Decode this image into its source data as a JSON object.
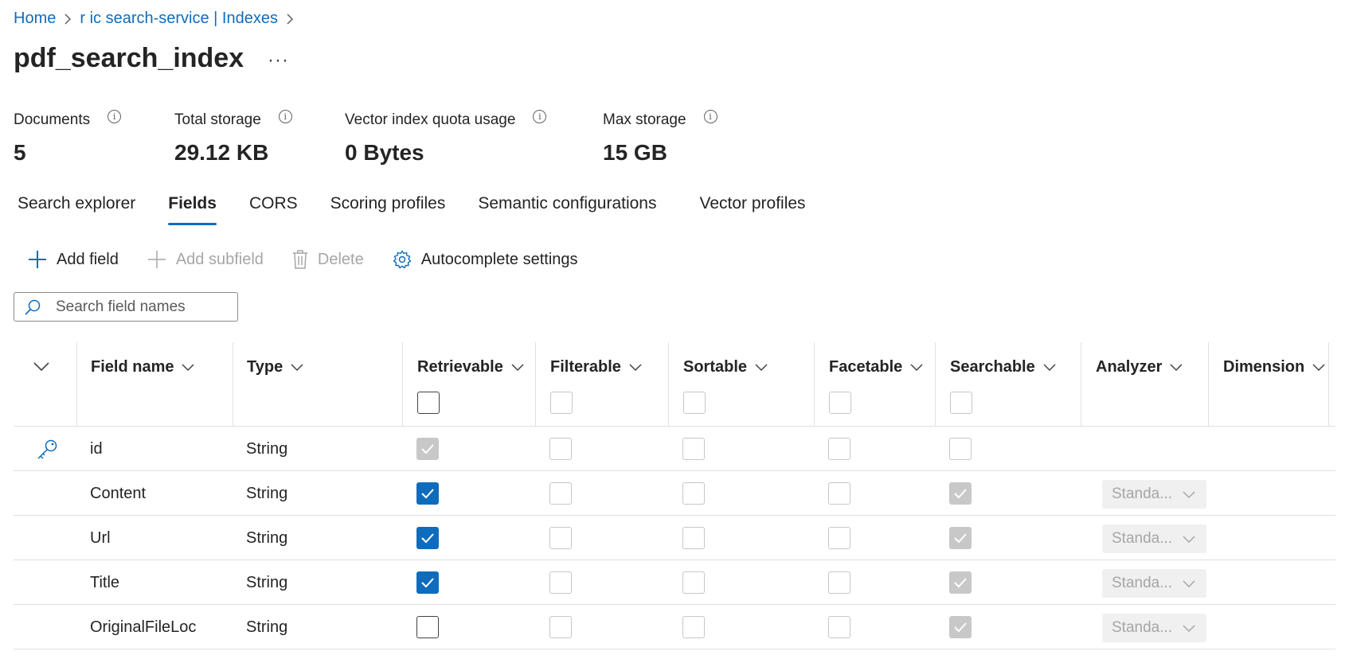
{
  "breadcrumb": {
    "home": "Home",
    "service": "r   ic search-service | Indexes"
  },
  "page": {
    "title": "pdf_search_index",
    "more": "···"
  },
  "stats": [
    {
      "label": "Documents",
      "value": "5"
    },
    {
      "label": "Total storage",
      "value": "29.12 KB"
    },
    {
      "label": "Vector index quota usage",
      "value": "0 Bytes"
    },
    {
      "label": "Max storage",
      "value": "15 GB"
    }
  ],
  "tabs": [
    {
      "label": "Search explorer",
      "active": false
    },
    {
      "label": "Fields",
      "active": true
    },
    {
      "label": "CORS",
      "active": false
    },
    {
      "label": "Scoring profiles",
      "active": false
    },
    {
      "label": "Semantic configurations",
      "active": false
    },
    {
      "label": "Vector profiles",
      "active": false
    }
  ],
  "toolbar": {
    "add_field": "Add field",
    "add_subfield": "Add subfield",
    "delete": "Delete",
    "autocomplete": "Autocomplete settings"
  },
  "search": {
    "placeholder": "Search field names"
  },
  "table": {
    "columns": [
      "Field name",
      "Type",
      "Retrievable",
      "Filterable",
      "Sortable",
      "Facetable",
      "Searchable",
      "Analyzer",
      "Dimension"
    ],
    "rows": [
      {
        "name": "id",
        "type": "String",
        "key": true,
        "retrievable": "grey",
        "filterable": "empty",
        "sortable": "empty",
        "facetable": "empty",
        "searchable": "empty",
        "analyzer": ""
      },
      {
        "name": "Content",
        "type": "String",
        "key": false,
        "retrievable": "checked",
        "filterable": "empty",
        "sortable": "empty",
        "facetable": "empty",
        "searchable": "grey",
        "analyzer": "Standa..."
      },
      {
        "name": "Url",
        "type": "String",
        "key": false,
        "retrievable": "checked",
        "filterable": "empty",
        "sortable": "empty",
        "facetable": "empty",
        "searchable": "grey",
        "analyzer": "Standa..."
      },
      {
        "name": "Title",
        "type": "String",
        "key": false,
        "retrievable": "checked",
        "filterable": "empty",
        "sortable": "empty",
        "facetable": "empty",
        "searchable": "grey",
        "analyzer": "Standa..."
      },
      {
        "name": "OriginalFileLoc",
        "type": "String",
        "key": false,
        "retrievable": "strong",
        "filterable": "empty",
        "sortable": "empty",
        "facetable": "empty",
        "searchable": "grey",
        "analyzer": "Standa..."
      }
    ]
  },
  "colors": {
    "accent": "#0f6cbd",
    "text": "#242424",
    "disabled": "#a6a6a6"
  }
}
